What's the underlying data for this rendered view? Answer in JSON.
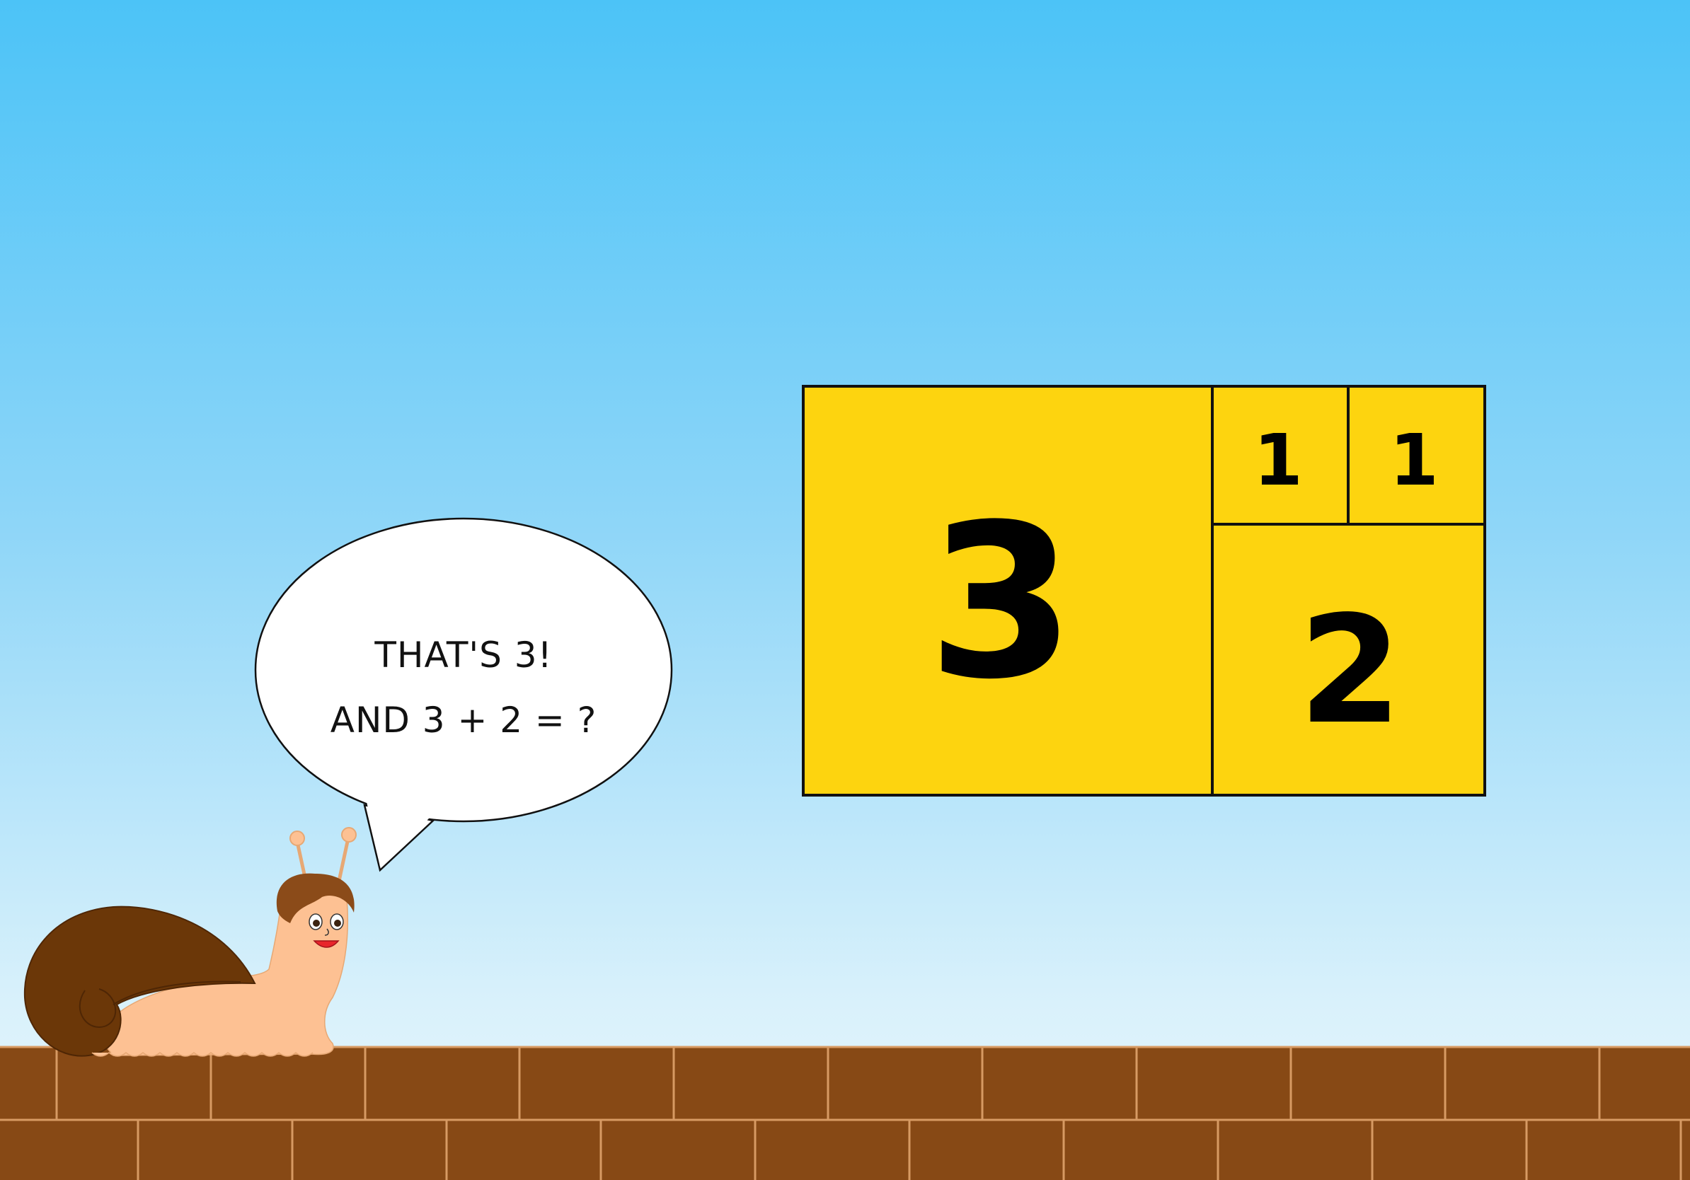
{
  "speech_bubble": {
    "line1": "THAT'S 3!",
    "line2": "AND 3 + 2 = ?"
  },
  "tiles": {
    "big": "3",
    "small_left": "1",
    "small_right": "1",
    "medium": "2"
  },
  "colors": {
    "sky_top": "#4cc3f7",
    "sky_bottom": "#e6f6fd",
    "tile_yellow": "#fdd40f",
    "brick": "#874915",
    "brick_mortar": "#d79a63",
    "shell": "#6b3708",
    "snail_body": "#fdc193",
    "hair": "#8b4b19"
  }
}
